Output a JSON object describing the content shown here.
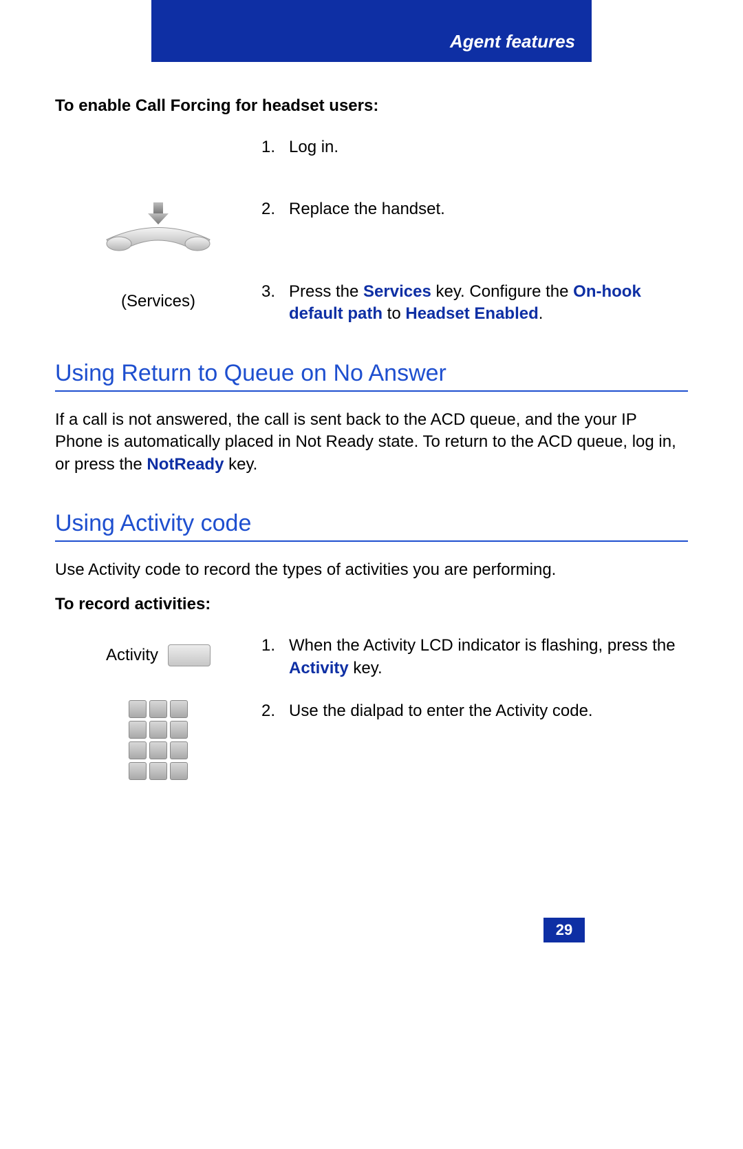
{
  "header": {
    "title": "Agent features"
  },
  "intro1": "To enable Call Forcing for headset users:",
  "steps1": {
    "s1": {
      "num": "1.",
      "text": "Log in."
    },
    "s2": {
      "num": "2.",
      "text": "Replace the handset."
    },
    "s3": {
      "num": "3.",
      "pre": "Press the ",
      "kw1": "Services",
      "mid": " key. Configure the ",
      "kw2": "On-hook default path",
      "mid2": " to ",
      "kw3": "Headset Enabled",
      "post": "."
    },
    "services_label": "(Services)"
  },
  "section_a": {
    "heading": "Using Return to Queue on No Answer",
    "p_pre": "If a call is not answered, the call is sent back to the ACD queue, and the your IP Phone is automatically placed in Not Ready state. To return to the ACD queue, log in, or press the ",
    "p_kw": "NotReady",
    "p_post": " key."
  },
  "section_b": {
    "heading": "Using Activity code",
    "p": "Use Activity code to record the types of activities you are performing.",
    "intro": "To record activities:",
    "activity_label": "Activity",
    "s1": {
      "num": "1.",
      "pre": "When the Activity LCD indicator is flashing, press the ",
      "kw": "Activity",
      "post": " key."
    },
    "s2": {
      "num": "2.",
      "text": "Use the dialpad to enter the Activity code."
    }
  },
  "page_number": "29"
}
